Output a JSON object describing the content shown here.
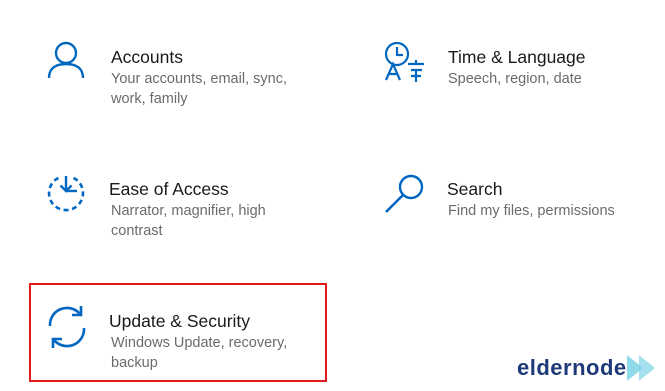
{
  "tiles": [
    {
      "title": "Accounts",
      "description": "Your accounts, email, sync, work, family",
      "icon": "person-icon"
    },
    {
      "title": "Time & Language",
      "description": "Speech, region, date",
      "icon": "clock-language-icon"
    },
    {
      "title": "Ease of Access",
      "description": "Narrator, magnifier, high contrast",
      "icon": "ease-of-access-timer-icon"
    },
    {
      "title": "Search",
      "description": "Find my files, permissions",
      "icon": "search-icon"
    },
    {
      "title": "Update & Security",
      "description": "Windows Update, recovery, backup",
      "icon": "sync-arrows-icon"
    }
  ],
  "highlighted_tile": "Update & Security",
  "watermark": {
    "text": "eldernode"
  },
  "colors": {
    "icon_blue": "#0067c0",
    "title_text": "#1a1a1a",
    "description_text": "#6b6b6b",
    "highlight_border": "#e01b1b",
    "watermark_text": "#1f3a78",
    "watermark_arrow": "#7ed3e6"
  }
}
